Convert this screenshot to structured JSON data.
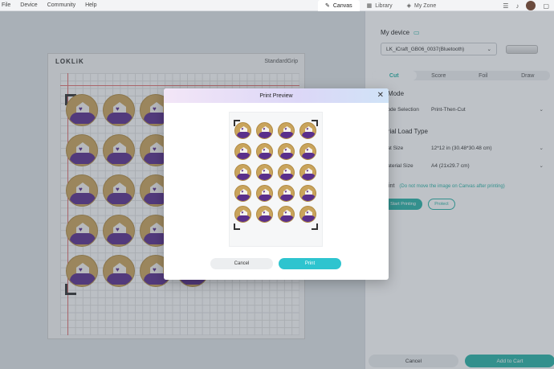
{
  "menu": [
    "File",
    "Device",
    "Community",
    "Help"
  ],
  "tabs": [
    {
      "label": "Canvas",
      "icon": "canvas-icon",
      "active": true
    },
    {
      "label": "Library",
      "icon": "library-icon",
      "active": false
    },
    {
      "label": "My Zone",
      "icon": "my-zone-icon",
      "active": false
    }
  ],
  "toolbar_icons": [
    "list-icon",
    "bell-icon",
    "avatar"
  ],
  "mat": {
    "brand": "LOKLiK",
    "grip": "StandardGrip"
  },
  "panel": {
    "my_device": "My device",
    "device": "LK_iCraft_GB06_0037(Bluetooth)",
    "modes": [
      "Cut",
      "Score",
      "Foil",
      "Draw"
    ],
    "mode_heading": "Mode",
    "mode_selection_label": "Mode Selection",
    "mode_selection_value": "Print-Then-Cut",
    "material_heading": "Material Load Type",
    "mat_size_label": "Mat Size",
    "mat_size_value": "12*12 in (30.48*30.48 cm)",
    "material_size_label": "Material Size",
    "material_size_value": "A4 (21x29.7 cm)",
    "print_label": "Print",
    "print_note": "(Do not move the image on Canvas after printing)",
    "start_printing": "Start Printing",
    "protect": "Protect",
    "cancel": "Cancel",
    "next": "Add to Cart"
  },
  "modal": {
    "title": "Print Preview",
    "cancel": "Cancel",
    "print": "Print"
  },
  "colors": {
    "accent": "#2ab3a6",
    "print_button": "#2ec4cf",
    "sticker_gold": "#c9a45c",
    "sticker_purple": "#5a2f8c"
  }
}
